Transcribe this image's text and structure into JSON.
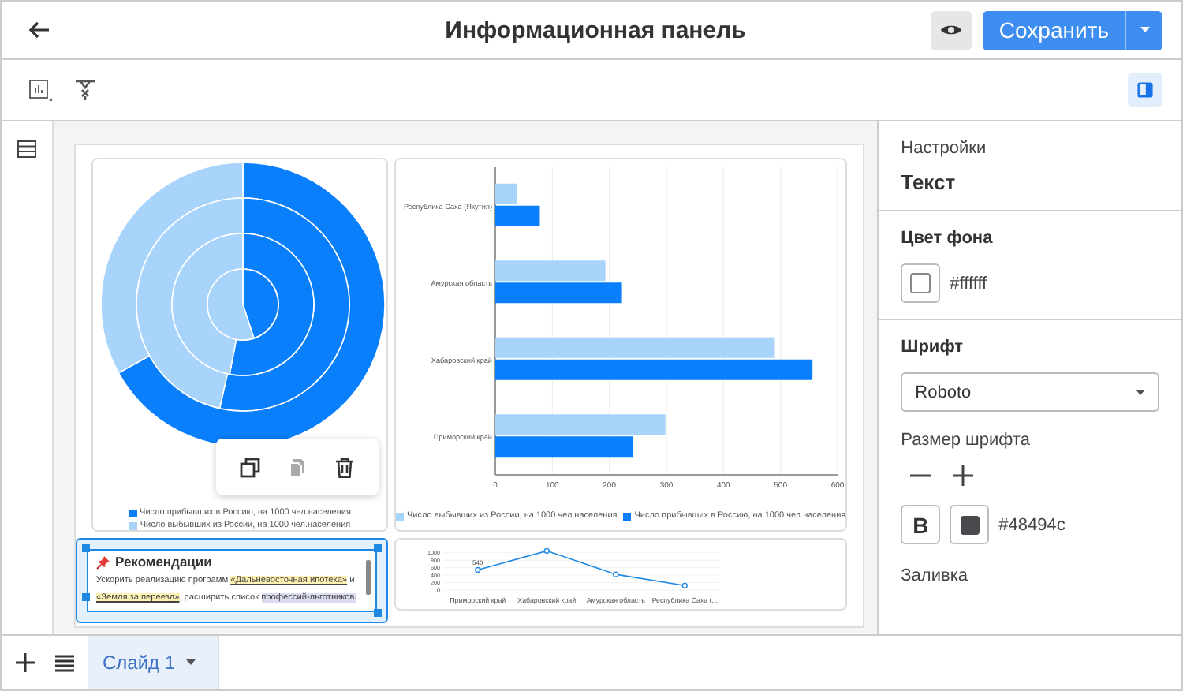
{
  "header": {
    "title": "Информационная панель",
    "save_label": "Сохранить"
  },
  "toolbar": {
    "panel_toggle": {
      "on": true
    }
  },
  "pie": {
    "chart_data": {
      "type": "pie",
      "categories": [
        "Число прибывших в Россию, на 1000 чел.населения",
        "Число выбывших из России, на 1000 чел.населения"
      ],
      "series": [
        {
          "colors": [
            "#0a7ffb",
            "#a8d4fc"
          ],
          "values": [
            67,
            33
          ]
        },
        {
          "colors": [
            "#0a7ffb",
            "#a8d4fc"
          ],
          "values": [
            53.5,
            46.5
          ]
        },
        {
          "colors": [
            "#0a7ffb",
            "#a8d4fc"
          ],
          "values": [
            53,
            47
          ]
        },
        {
          "colors": [
            "#0a7ffb",
            "#a8d4fc"
          ],
          "values": [
            45,
            55
          ]
        }
      ]
    },
    "actions": [
      {
        "kind": "copy",
        "disabled": false
      },
      {
        "kind": "paste",
        "disabled": true
      },
      {
        "kind": "delete",
        "disabled": false
      }
    ]
  },
  "bars": {
    "chart_data": {
      "type": "bar",
      "orientation": "horizontal",
      "grid": true,
      "categories": [
        "Республика Саха (Якутия)",
        "Амурская область",
        "Хабаровский край",
        "Приморский край"
      ],
      "series": [
        {
          "name": "Число выбывших из России, на 1000 чел.населения",
          "color": "#a8d4fc",
          "values": [
            38,
            193,
            490,
            298
          ]
        },
        {
          "name": "Число прибывших в Россию, на 1000 чел.населения",
          "color": "#0a7ffb",
          "values": [
            78,
            222,
            556,
            242
          ]
        }
      ],
      "xlim": [
        0,
        600
      ],
      "xticks": [
        0,
        100,
        200,
        300,
        400,
        500,
        600
      ]
    }
  },
  "text_widget": {
    "title": "Рекомендации",
    "paragraph": [
      {
        "kind": "plain",
        "text": "Ускорить реализацию программ "
      },
      {
        "kind": "mark",
        "text": "«Дальневосточная ипотека»"
      },
      {
        "kind": "plain",
        "text": " и "
      },
      {
        "kind": "mark",
        "text": "«Земля за переезд»"
      },
      {
        "kind": "plain",
        "text": ", расширить список "
      },
      {
        "kind": "tag",
        "text": "профессий-льготников."
      }
    ]
  },
  "line": {
    "chart_data": {
      "type": "line",
      "grid": true,
      "categories": [
        "Приморский край",
        "Хабаровский край",
        "Амурская область",
        "Республика Саха (..."
      ],
      "series": [
        {
          "color": "#1e88e5",
          "marker": "circle",
          "values": [
            540,
            1050,
            420,
            120
          ]
        }
      ],
      "ylim": [
        0,
        1100
      ],
      "yticks": [
        0,
        200,
        400,
        600,
        800,
        1000
      ],
      "annotations": [
        {
          "x": "Приморский край",
          "y": 540,
          "text": "540"
        }
      ]
    }
  },
  "panel": {
    "caption": "Настройки",
    "title": "Текст",
    "background_heading": "Цвет фона",
    "background_value": "#ffffff",
    "font_heading": "Шрифт",
    "font_value": "Roboto",
    "size_heading": "Размер шрифта",
    "bold": {
      "on": false,
      "label": "B"
    },
    "text_color_value": "#48494c",
    "fill_heading": "Заливка"
  },
  "slides": [
    {
      "label": "Слайд 1",
      "selected": true
    }
  ]
}
